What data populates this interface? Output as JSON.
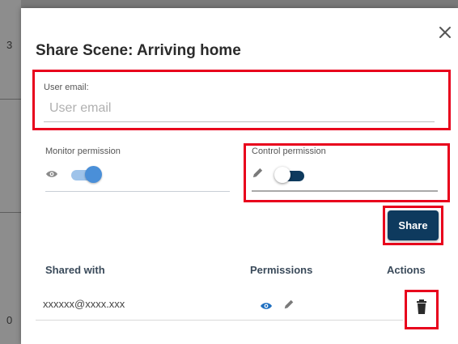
{
  "backdrop": {
    "chars": [
      "3",
      "0"
    ]
  },
  "dialog": {
    "title": "Share Scene: Arriving home",
    "close_icon": "close-icon"
  },
  "email": {
    "label": "User email:",
    "placeholder": "User email",
    "value": ""
  },
  "monitor": {
    "label": "Monitor permission",
    "icon": "eye-icon",
    "enabled": true
  },
  "control": {
    "label": "Control permission",
    "icon": "pencil-icon",
    "enabled": false
  },
  "share_button": {
    "label": "Share"
  },
  "table": {
    "headers": {
      "shared_with": "Shared with",
      "permissions": "Permissions",
      "actions": "Actions"
    },
    "rows": [
      {
        "email": "xxxxxx@xxxx.xxx",
        "permission_icons": [
          "eye-icon",
          "pencil-icon"
        ],
        "action_icon": "trash-icon"
      }
    ]
  },
  "colors": {
    "highlight_red": "#e8001c",
    "primary_navy": "#0e3a5e",
    "toggle_blue": "#4a8fd8",
    "eye_blue": "#1f6fc0"
  }
}
